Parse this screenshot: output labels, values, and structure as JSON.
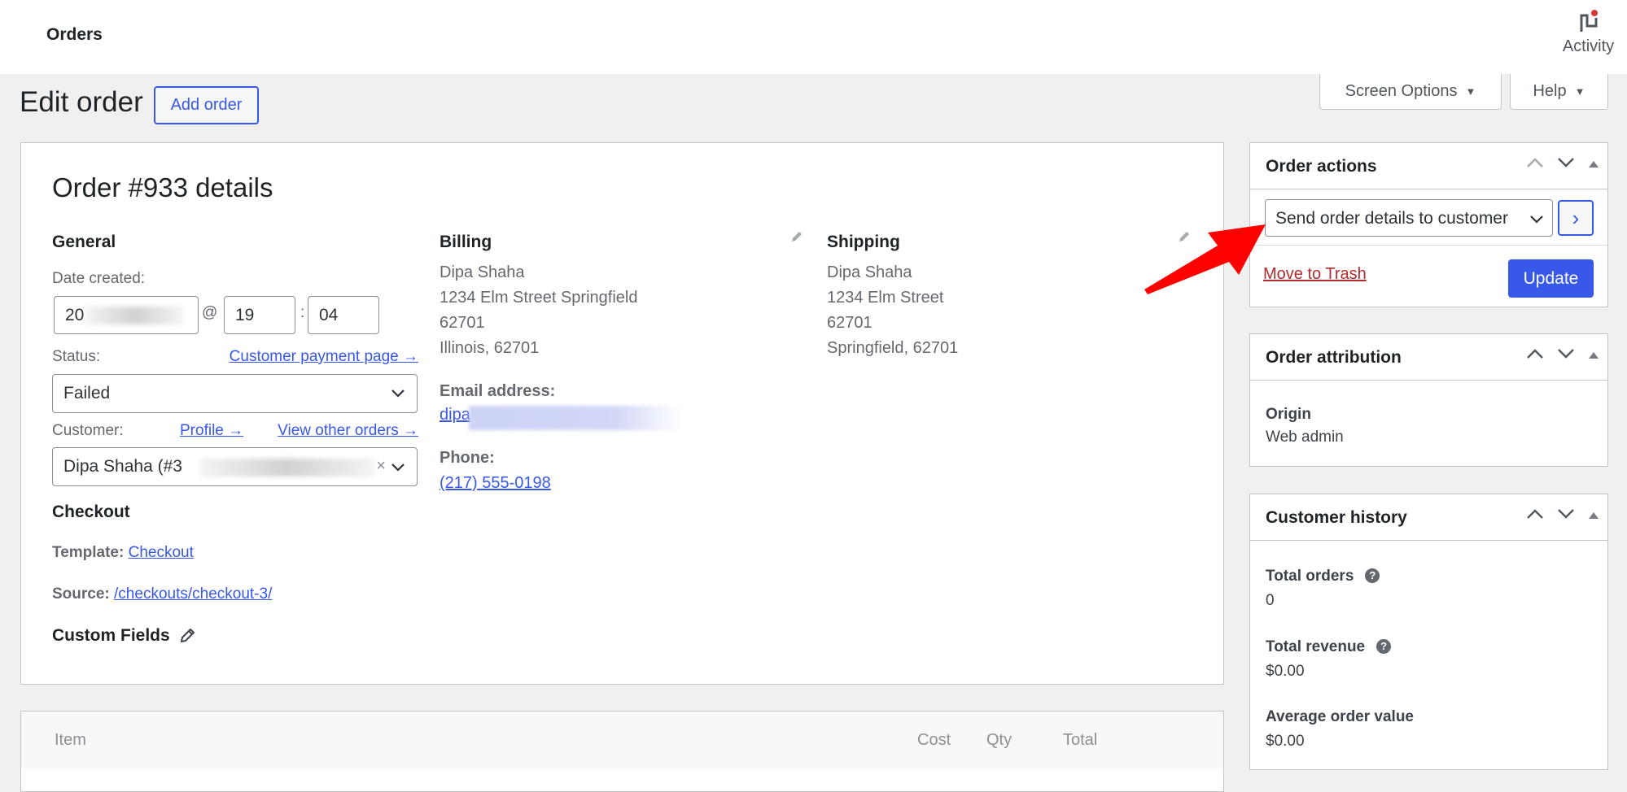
{
  "topbar": {
    "title": "Orders",
    "activity_label": "Activity"
  },
  "screen_options": {
    "screen_options_label": "Screen Options",
    "help_label": "Help"
  },
  "header": {
    "page_title": "Edit order",
    "add_order_label": "Add order"
  },
  "order": {
    "title": "Order #933 details",
    "general": {
      "heading": "General",
      "date_created_label": "Date created:",
      "date_value_visible": "20",
      "hour": "19",
      "minute": "04",
      "at_sep": "@",
      "colon_sep": ":",
      "status_label": "Status:",
      "customer_payment_link": "Customer payment page →",
      "status_value": "Failed",
      "customer_label": "Customer:",
      "profile_link": "Profile →",
      "view_other_orders_link": "View other orders →",
      "customer_value_visible": "Dipa Shaha (#3",
      "clear_symbol": "×"
    },
    "checkout": {
      "heading": "Checkout",
      "template_label": "Template:",
      "template_link": "Checkout",
      "source_label": "Source:",
      "source_link": "/checkouts/checkout-3/"
    },
    "custom_fields": {
      "heading": "Custom Fields"
    },
    "billing": {
      "heading": "Billing",
      "address_lines": [
        "Dipa Shaha",
        "1234 Elm Street Springfield",
        "62701",
        "Illinois, 62701"
      ],
      "email_label": "Email address:",
      "email_visible": "dipa",
      "phone_label": "Phone:",
      "phone_value": "(217) 555-0198"
    },
    "shipping": {
      "heading": "Shipping",
      "address_lines": [
        "Dipa Shaha",
        "1234 Elm Street",
        "62701",
        "Springfield, 62701"
      ]
    }
  },
  "items_table": {
    "columns": [
      "Item",
      "Cost",
      "Qty",
      "Total"
    ]
  },
  "order_actions": {
    "heading": "Order actions",
    "action_selected": "Send order details to customer",
    "apply_symbol": "›",
    "trash_link": "Move to Trash",
    "update_label": "Update"
  },
  "order_attribution": {
    "heading": "Order attribution",
    "origin_label": "Origin",
    "origin_value": "Web admin"
  },
  "customer_history": {
    "heading": "Customer history",
    "stats": [
      {
        "label": "Total orders",
        "value": "0",
        "help": true
      },
      {
        "label": "Total revenue",
        "value": "$0.00",
        "help": true
      },
      {
        "label": "Average order value",
        "value": "$0.00",
        "help": false
      }
    ]
  },
  "colors": {
    "accent": "#3858e9",
    "danger": "#b32d2e",
    "annotation_arrow": "#ff0000",
    "notification_dot": "#d63638"
  }
}
